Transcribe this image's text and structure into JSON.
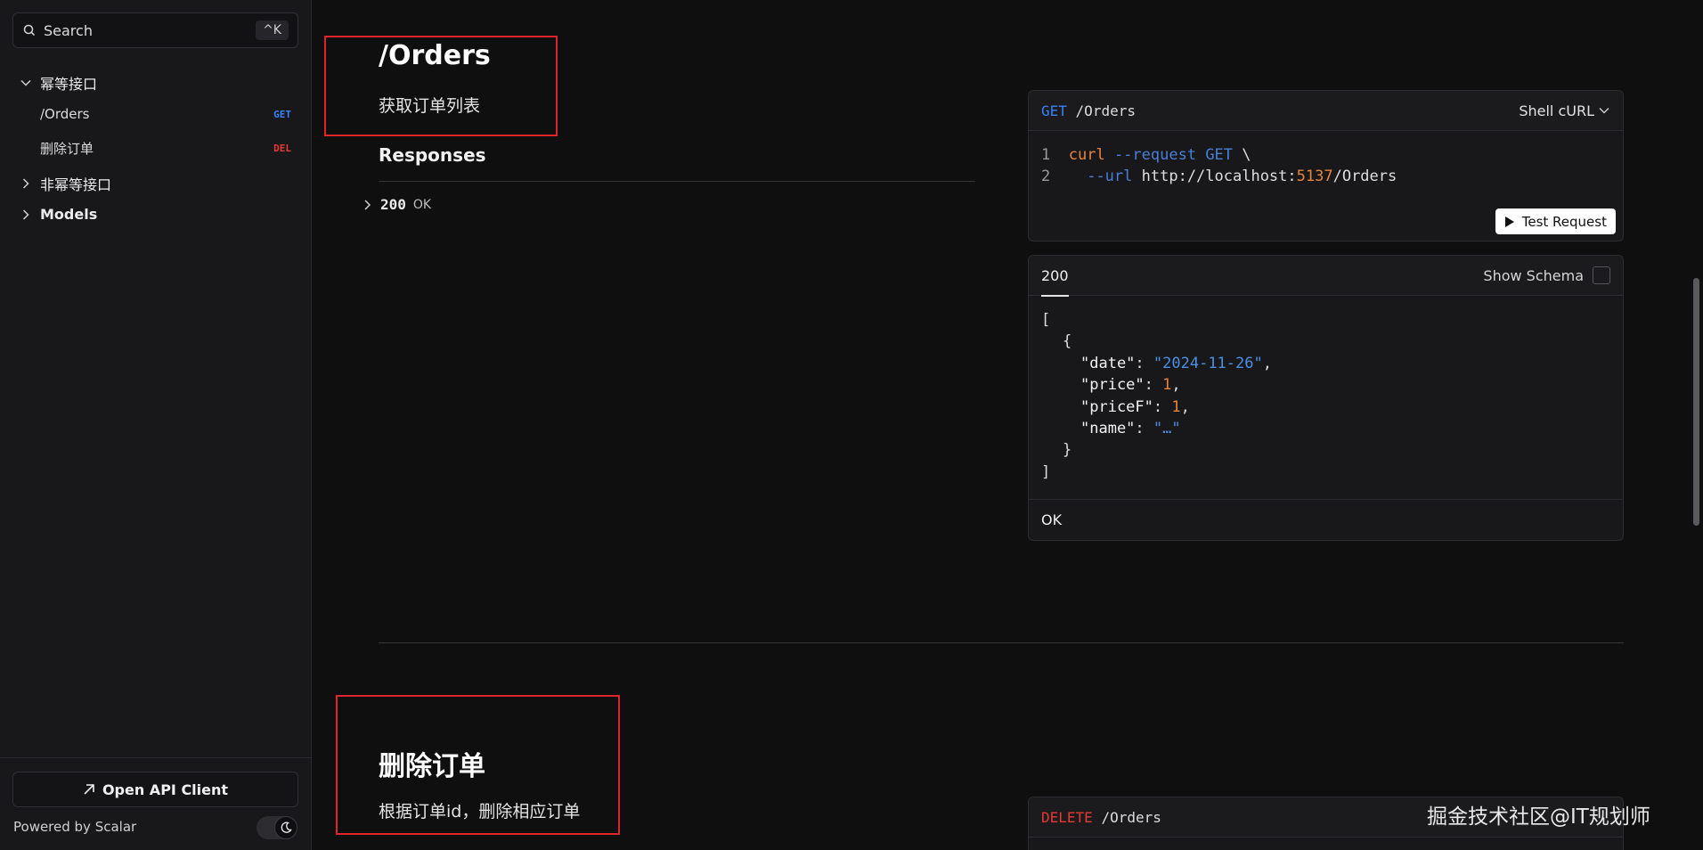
{
  "sidebar": {
    "search_placeholder": "Search",
    "search_shortcut": "^K",
    "groups": [
      {
        "label": "幂等接口",
        "expanded": true
      },
      {
        "label": "非幂等接口",
        "expanded": false
      },
      {
        "label": "Models",
        "expanded": false
      }
    ],
    "items": [
      {
        "label": "/Orders",
        "method": "GET"
      },
      {
        "label": "删除订单",
        "method": "DEL"
      }
    ],
    "open_client_label": "Open API Client",
    "powered_by": "Powered by Scalar"
  },
  "section1": {
    "title": "/Orders",
    "description": "获取订单列表",
    "responses_title": "Responses",
    "response_code": "200",
    "response_text": "OK"
  },
  "request_panel": {
    "method": "GET",
    "path": "/Orders",
    "language": "Shell cURL",
    "line1": {
      "num": "1",
      "cmd": "curl",
      "flag": "--request",
      "method": "GET",
      "cont": "\\"
    },
    "line2": {
      "num": "2",
      "flag": "--url",
      "url_prefix": "http://localhost:",
      "port": "5137",
      "url_path": "/Orders"
    },
    "test_button": "Test Request"
  },
  "response_panel": {
    "tab": "200",
    "show_schema": "Show Schema",
    "open_bracket": "[",
    "open_brace": "{",
    "fields": [
      {
        "key": "\"date\"",
        "value": "\"2024-11-26\"",
        "type": "str",
        "comma": ","
      },
      {
        "key": "\"price\"",
        "value": "1",
        "type": "num",
        "comma": ","
      },
      {
        "key": "\"priceF\"",
        "value": "1",
        "type": "num",
        "comma": ","
      },
      {
        "key": "\"name\"",
        "value": "\"…\"",
        "type": "str",
        "comma": ""
      }
    ],
    "close_brace": "}",
    "close_bracket": "]",
    "footer": "OK"
  },
  "section2": {
    "title": "删除订单",
    "description": "根据订单id，删除相应订单",
    "method": "DELETE",
    "path": "/Orders"
  },
  "watermark": "掘金技术社区@IT规划师",
  "colors": {
    "accent_get": "#3b82f6",
    "accent_delete": "#e53935",
    "highlight_box": "#e0242d"
  }
}
